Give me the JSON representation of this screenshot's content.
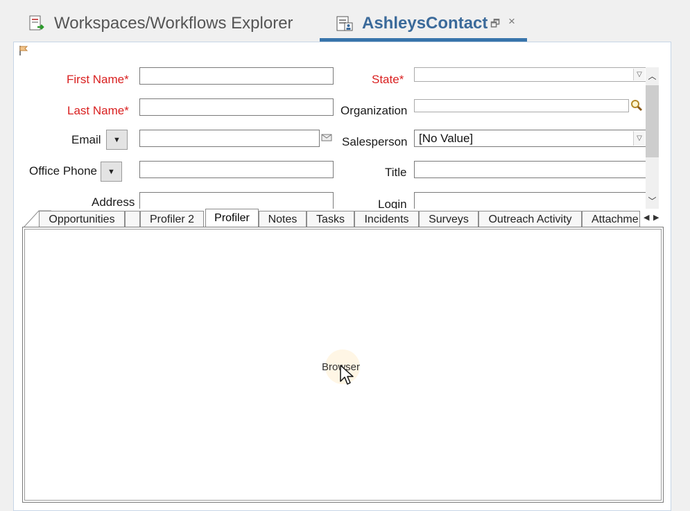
{
  "tabs": [
    {
      "label": "Workspaces/Workflows Explorer",
      "icon": "workflow-explorer-icon"
    },
    {
      "label": "AshleysContact",
      "icon": "contact-record-icon",
      "active": true
    }
  ],
  "tab_controls": {
    "restore": "🗗",
    "close": "×"
  },
  "form": {
    "left": [
      {
        "label": "First Name*",
        "required": true
      },
      {
        "label": "Last Name*",
        "required": true
      },
      {
        "label": "Email",
        "required": false
      },
      {
        "label": "Office Phone",
        "required": false
      },
      {
        "label": "Address",
        "required": false
      }
    ],
    "right": [
      {
        "label": "State*",
        "required": true
      },
      {
        "label": "Organization",
        "required": false
      },
      {
        "label": "Salesperson",
        "required": false,
        "value": "[No Value]"
      },
      {
        "label": "Title",
        "required": false
      },
      {
        "label": "Login",
        "required": false
      }
    ]
  },
  "detail_tabs": [
    "Opportunities",
    "",
    "Profiler 2",
    "Profiler",
    "Notes",
    "Tasks",
    "Incidents",
    "Surveys",
    "Outreach Activity",
    "Attachme"
  ],
  "active_detail_tab": "Profiler",
  "content": {
    "placeholder": "Browser"
  },
  "colors": {
    "accent": "#3874ab",
    "required": "#d91f1f",
    "active_tab_text": "#3b6a9a"
  }
}
